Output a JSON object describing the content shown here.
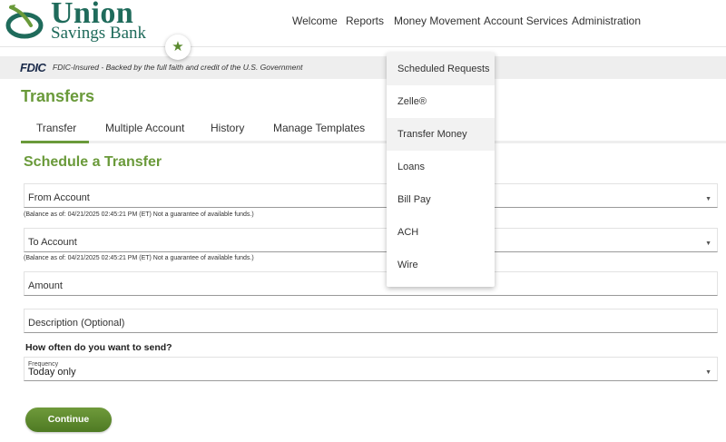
{
  "brand": {
    "name": "Union",
    "sub": "Savings Bank",
    "colors": {
      "primary_green": "#6a9a3a",
      "brand_teal": "#1f6b5b",
      "button_green": "#5a8a2f"
    }
  },
  "favorite": {
    "icon": "star-icon",
    "glyph": "★"
  },
  "nav": {
    "items": [
      "Welcome",
      "Reports",
      "Money Movement",
      "Account Services",
      "Administration"
    ]
  },
  "fdic": {
    "logo": "FDIC",
    "text": "FDIC-Insured - Backed by the full faith and credit of the U.S. Government"
  },
  "page": {
    "title": "Transfers"
  },
  "tabs": [
    "Transfer",
    "Multiple Account",
    "History",
    "Manage Templates"
  ],
  "active_tab": "Transfer",
  "form": {
    "section_title": "Schedule a Transfer",
    "from_account": {
      "label": "From Account",
      "note": "(Balance as of: 04/21/2025 02:45:21 PM (ET) Not a guarantee of available funds.)"
    },
    "to_account": {
      "label": "To Account",
      "note": "(Balance as of: 04/21/2025 02:45:21 PM (ET) Not a guarantee of available funds.)"
    },
    "amount": {
      "label": "Amount"
    },
    "description": {
      "label": "Description (Optional)"
    },
    "question": "How often do you want to send?",
    "frequency": {
      "label": "Frequency",
      "value": "Today only"
    },
    "continue_label": "Continue"
  },
  "dropdown": {
    "items": [
      "Scheduled Requests",
      "Zelle®",
      "Transfer Money",
      "Loans",
      "Bill Pay",
      "ACH",
      "Wire"
    ],
    "highlighted": [
      "Scheduled Requests",
      "Transfer Money"
    ]
  },
  "caret_glyph": "▼"
}
